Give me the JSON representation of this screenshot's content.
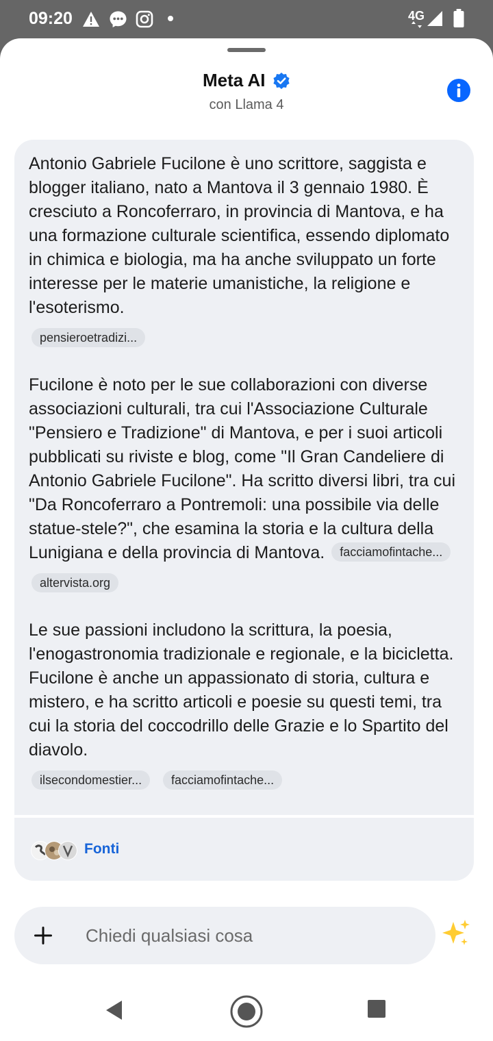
{
  "status_bar": {
    "time": "09:20",
    "network": "4G",
    "icons": [
      "alert-icon",
      "messenger-icon",
      "instagram-icon",
      "dot-icon",
      "signal-icon",
      "battery-icon"
    ]
  },
  "header": {
    "title": "Meta AI",
    "subtitle": "con Llama 4",
    "verified_icon": "verified-badge-icon",
    "info_icon": "info-icon"
  },
  "message": {
    "paragraphs": [
      {
        "text": "Antonio Gabriele Fucilone è uno scrittore, saggista e blogger italiano, nato a Mantova il 3 gennaio 1980. È cresciuto a Roncoferraro, in provincia di Mantova, e ha una formazione culturale scientifica, essendo diplomato in chimica e biologia, ma ha anche sviluppato un forte interesse per le materie umanistiche, la religione e l'esoterismo.",
        "chips": [
          "pensieroetradizi..."
        ]
      },
      {
        "text": "Fucilone è noto per le sue collaborazioni con diverse associazioni culturali, tra cui l'Associazione Culturale \"Pensiero e Tradizione\" di Mantova, e per i suoi articoli pubblicati su riviste e blog, come \"Il Gran Candeliere di Antonio Gabriele Fucilone\". Ha scritto diversi libri, tra cui \"Da Roncoferraro a Pontremoli: una possibile via delle statue-stele?\", che esamina la storia e la cultura della Lunigiana e della provincia di Mantova.",
        "inline_chip": "facciamofintache...",
        "chips": [
          "altervista.org"
        ]
      },
      {
        "text": "Le sue passioni includono la scrittura, la poesia, l'enogastronomia tradizionale e regionale, e la bicicletta. Fucilone è anche un appassionato di storia, cultura e mistero, e ha scritto articoli e poesie su questi temi, tra cui la storia del coccodrillo delle Grazie e lo Spartito del diavolo.",
        "chips": [
          "ilsecondomestier...",
          "facciamofintache..."
        ]
      }
    ],
    "sources_label": "Fonti"
  },
  "composer": {
    "placeholder": "Chiedi qualsiasi cosa",
    "value": "",
    "plus_icon": "plus-icon",
    "sparkle_icon": "sparkle-icon"
  },
  "nav_bar": {
    "icons": [
      "back-icon",
      "home-icon",
      "recents-icon"
    ]
  },
  "colors": {
    "accent": "#1764d8",
    "card_bg": "#eef0f4",
    "status_bar": "#666666"
  }
}
